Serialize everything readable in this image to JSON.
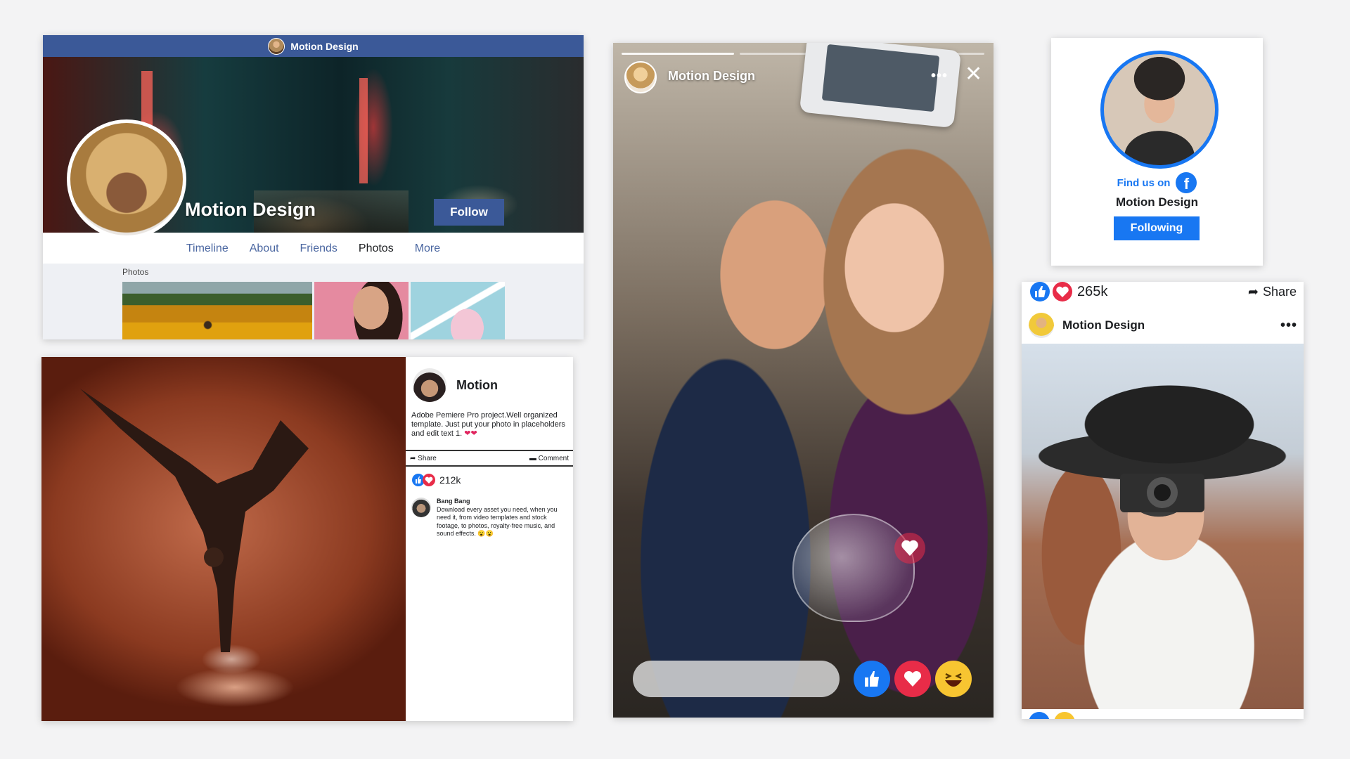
{
  "profile_card": {
    "topbar_title": "Motion Design",
    "name": "Motion Design",
    "follow_label": "Follow",
    "tabs": [
      "Timeline",
      "About",
      "Friends",
      "Photos",
      "More"
    ],
    "active_tab": "Photos",
    "photos_label": "Photos"
  },
  "post_card": {
    "author": "Motion",
    "description": "Adobe Pemiere Pro project.Well organized template. Just put your photo in placeholders and edit text 1.",
    "description_emoji": "❤❤",
    "share_label": "Share",
    "comment_label": "Comment",
    "reaction_count": "212k",
    "comment": {
      "author": "Bang Bang",
      "text": "Download every asset you need, when you need it, from video templates and stock footage, to photos, royalty-free music, and sound effects.",
      "emoji": "😮😮"
    }
  },
  "story_card": {
    "author": "Motion Design",
    "more_icon": "more-horizontal-icon",
    "close_glyph": "✕",
    "reactions": [
      "like",
      "love",
      "haha"
    ]
  },
  "findus_card": {
    "find_text": "Find us on",
    "name": "Motion Design",
    "following_label": "Following",
    "accent": "#1877f2"
  },
  "photo_post_card": {
    "reaction_count": "265k",
    "share_label": "Share",
    "author": "Motion Design"
  },
  "colors": {
    "facebook_blue": "#3b5998",
    "like_blue": "#1877f2",
    "love_red": "#e82c48",
    "haha_yellow": "#f7c531"
  }
}
